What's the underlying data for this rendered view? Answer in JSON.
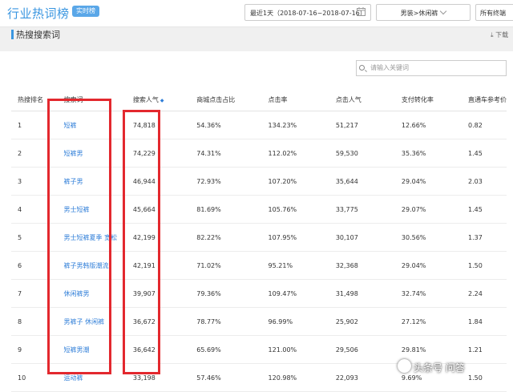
{
  "header": {
    "title": "行业热词榜",
    "badge": "实时榜",
    "date_range": "最近1天（2018-07-16~2018-07-16）",
    "category": "男装>休闲裤",
    "terminal": "所有终端"
  },
  "section": {
    "title": "热搜搜索词",
    "download": "下载"
  },
  "search": {
    "placeholder": "请输入关键词"
  },
  "table": {
    "headers": [
      "热搜排名",
      "搜索词",
      "搜索人气",
      "商城点击占比",
      "点击率",
      "点击人气",
      "支付转化率",
      "直通车参考价"
    ],
    "rows": [
      [
        "1",
        "短裤",
        "74,818",
        "54.36%",
        "134.23%",
        "51,217",
        "12.66%",
        "0.82"
      ],
      [
        "2",
        "短裤男",
        "74,229",
        "74.31%",
        "112.02%",
        "59,530",
        "35.36%",
        "1.45"
      ],
      [
        "3",
        "裤子男",
        "46,944",
        "72.93%",
        "107.20%",
        "35,644",
        "29.04%",
        "2.03"
      ],
      [
        "4",
        "男士短裤",
        "45,664",
        "81.69%",
        "105.76%",
        "33,775",
        "29.07%",
        "1.45"
      ],
      [
        "5",
        "男士短裤夏季 宽松",
        "42,199",
        "82.22%",
        "107.95%",
        "30,107",
        "30.56%",
        "1.37"
      ],
      [
        "6",
        "裤子男韩版潮流",
        "42,191",
        "71.02%",
        "95.21%",
        "32,368",
        "29.04%",
        "1.50"
      ],
      [
        "7",
        "休闲裤男",
        "39,907",
        "79.36%",
        "109.47%",
        "31,498",
        "32.74%",
        "2.24"
      ],
      [
        "8",
        "男裤子 休闲裤",
        "36,672",
        "78.77%",
        "96.99%",
        "25,902",
        "27.12%",
        "1.84"
      ],
      [
        "9",
        "短裤男潮",
        "36,642",
        "65.69%",
        "121.00%",
        "29,506",
        "29.81%",
        "1.21"
      ],
      [
        "10",
        "运动裤",
        "33,198",
        "57.46%",
        "120.98%",
        "22,093",
        "9.69%",
        "1.50"
      ]
    ]
  },
  "watermark": "头条号 问答",
  "colors": {
    "accent": "#3a96e0",
    "highlight_box": "#e3282e",
    "link": "#2f7ed8"
  }
}
